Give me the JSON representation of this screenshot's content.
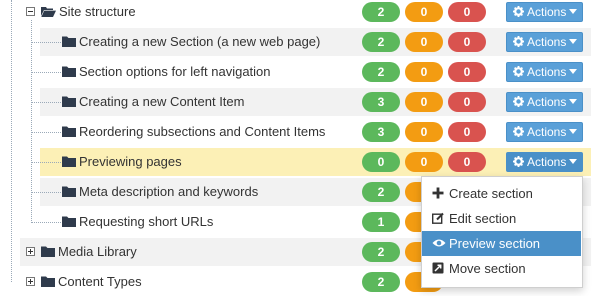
{
  "tree": {
    "root": {
      "label": "Site structure",
      "badges": {
        "green": "2",
        "orange": "0",
        "red": "0"
      },
      "actions_label": "Actions"
    },
    "children": [
      {
        "label": "Creating a new Section (a new web page)",
        "badges": {
          "green": "2",
          "orange": "0",
          "red": "0"
        },
        "actions_label": "Actions"
      },
      {
        "label": "Section options for left navigation",
        "badges": {
          "green": "2",
          "orange": "0",
          "red": "0"
        },
        "actions_label": "Actions"
      },
      {
        "label": "Creating a new Content Item",
        "badges": {
          "green": "3",
          "orange": "0",
          "red": "0"
        },
        "actions_label": "Actions"
      },
      {
        "label": "Reordering subsections and Content Items",
        "badges": {
          "green": "3",
          "orange": "0",
          "red": "0"
        },
        "actions_label": "Actions"
      },
      {
        "label": "Previewing pages",
        "badges": {
          "green": "0",
          "orange": "0",
          "red": "0"
        },
        "actions_label": "Actions"
      },
      {
        "label": "Meta description and keywords",
        "badges": {
          "green": "2"
        }
      },
      {
        "label": "Requesting short URLs",
        "badges": {
          "green": "1"
        }
      }
    ],
    "siblings": [
      {
        "label": "Media Library",
        "badges": {
          "green": "2"
        }
      },
      {
        "label": "Content Types",
        "badges": {
          "green": "2"
        }
      }
    ]
  },
  "dropdown": {
    "items": [
      {
        "label": "Create section",
        "icon": "plus-icon"
      },
      {
        "label": "Edit section",
        "icon": "edit-icon"
      },
      {
        "label": "Preview section",
        "icon": "eye-icon",
        "active": true
      },
      {
        "label": "Move section",
        "icon": "move-icon"
      }
    ]
  },
  "colors": {
    "green": "#5cb85c",
    "orange": "#f39c12",
    "red": "#d9534f",
    "actions": "#5aa0d8",
    "highlight": "#fcf0b6",
    "active_item": "#4a90c8"
  }
}
